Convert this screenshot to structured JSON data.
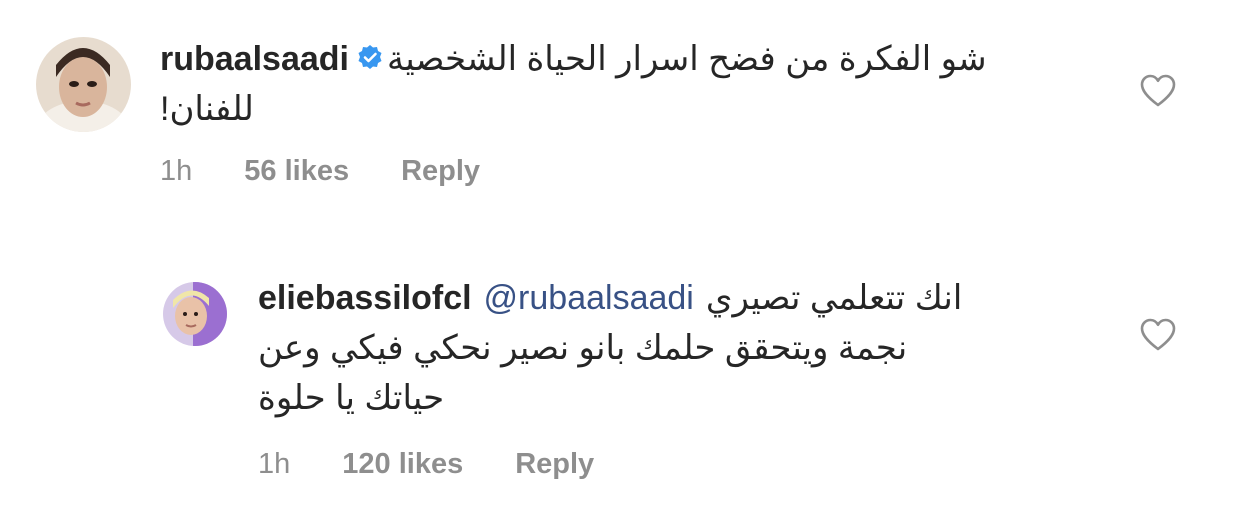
{
  "comments": [
    {
      "username": "rubaalsaadi",
      "verified": true,
      "text_line1": "شو الفكرة من فضح اسرار الحياة الشخصية",
      "text_line2": "للفنان!",
      "time": "1h",
      "likes": "56 likes",
      "reply": "Reply",
      "heart_icon": "heart-outline-icon",
      "verified_color": "#3897f0"
    },
    {
      "username": "eliebassilofcl",
      "mention": "@rubaalsaadi",
      "text_line1": "انك تتعلمي تصيري",
      "text_line2": "نجمة ويتحقق حلمك بانو نصير نحكي فيكي وعن",
      "text_line3": "حياتك يا حلوة",
      "time": "1h",
      "likes": "120 likes",
      "reply": "Reply",
      "heart_icon": "heart-outline-icon"
    }
  ],
  "colors": {
    "text": "#262626",
    "secondary": "#8e8e8e",
    "mention": "#385185",
    "verified": "#3897f0"
  }
}
